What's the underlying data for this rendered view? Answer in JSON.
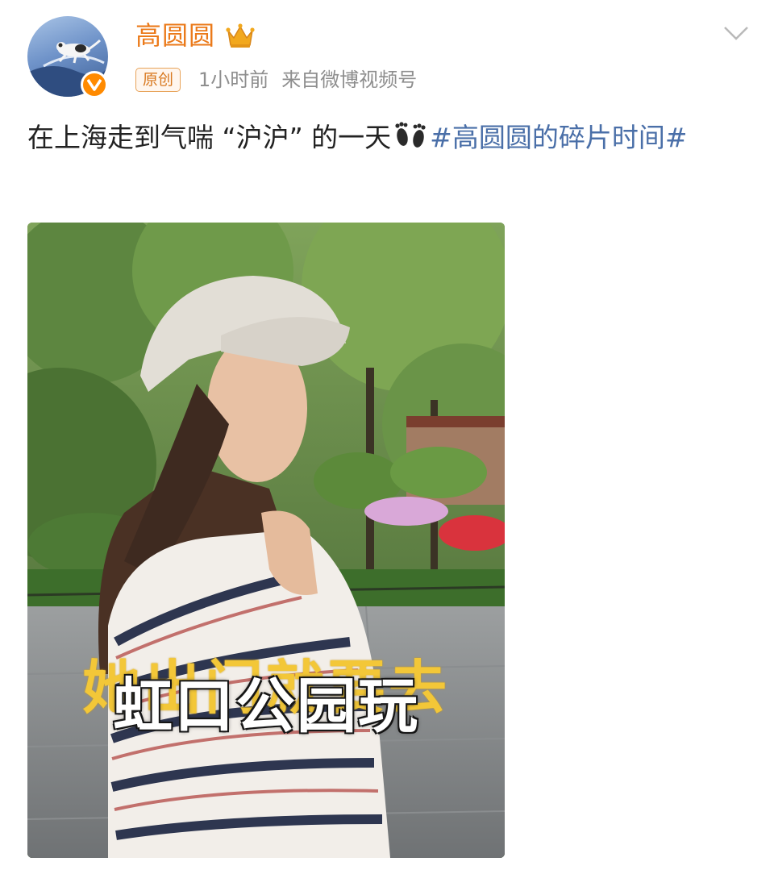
{
  "author": {
    "name": "高圆圆",
    "original_badge": "原创",
    "time": "1小时前",
    "source": "来自微博视频号",
    "icons": [
      "avatar",
      "verified-badge-icon",
      "crown-icon",
      "chevron-down-icon"
    ],
    "colors": {
      "name": "#eb7a1a",
      "badge": "#ff8a00"
    }
  },
  "post": {
    "text": "在上海走到气喘 “沪沪” 的一天",
    "emoji": "footprints-icon",
    "hashtag": "#高圆圆的碎片时间#",
    "hashtag_color": "#4a6fa8"
  },
  "media": {
    "type": "video-thumbnail",
    "caption_back": "她出门就要去",
    "caption_front": "虹口公园玩"
  }
}
